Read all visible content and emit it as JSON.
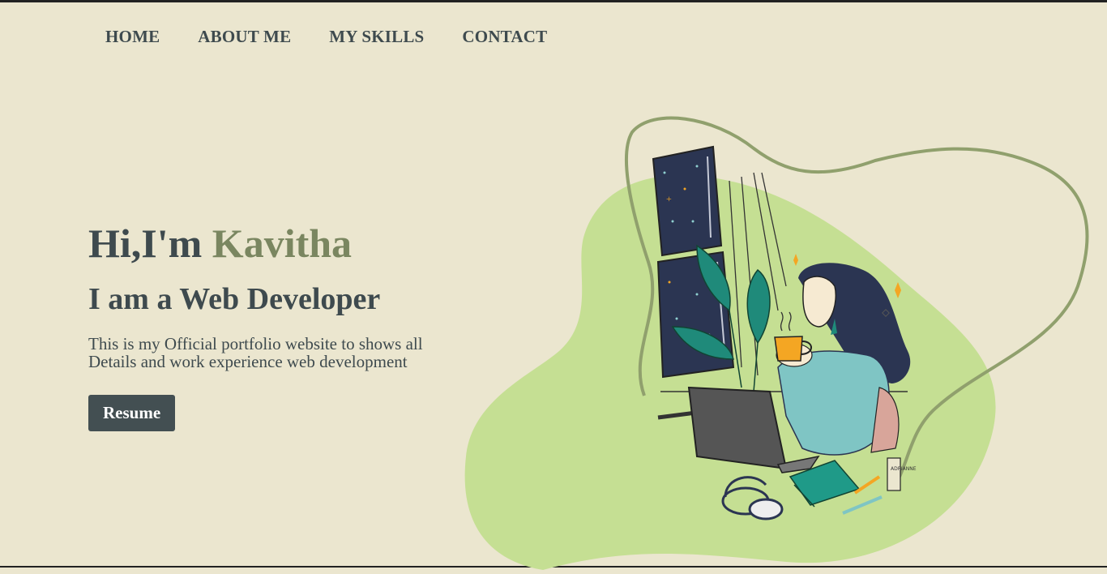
{
  "nav": {
    "items": [
      {
        "label": "HOME"
      },
      {
        "label": "ABOUT ME"
      },
      {
        "label": "MY SKILLS"
      },
      {
        "label": "CONTACT"
      }
    ]
  },
  "hero": {
    "greeting": "Hi,I'm ",
    "name": "Kavitha",
    "role": "I am a Web Developer",
    "description": "This is my Official portfolio website to shows all Details and work experience web development",
    "resume_label": "Resume"
  },
  "illustration": {
    "book_text": "ADRIANNE"
  },
  "colors": {
    "background": "#ebe6cf",
    "text": "#3e4a4e",
    "accent_name": "#7a8660",
    "blob": "#c5df93",
    "button": "#434f52"
  }
}
